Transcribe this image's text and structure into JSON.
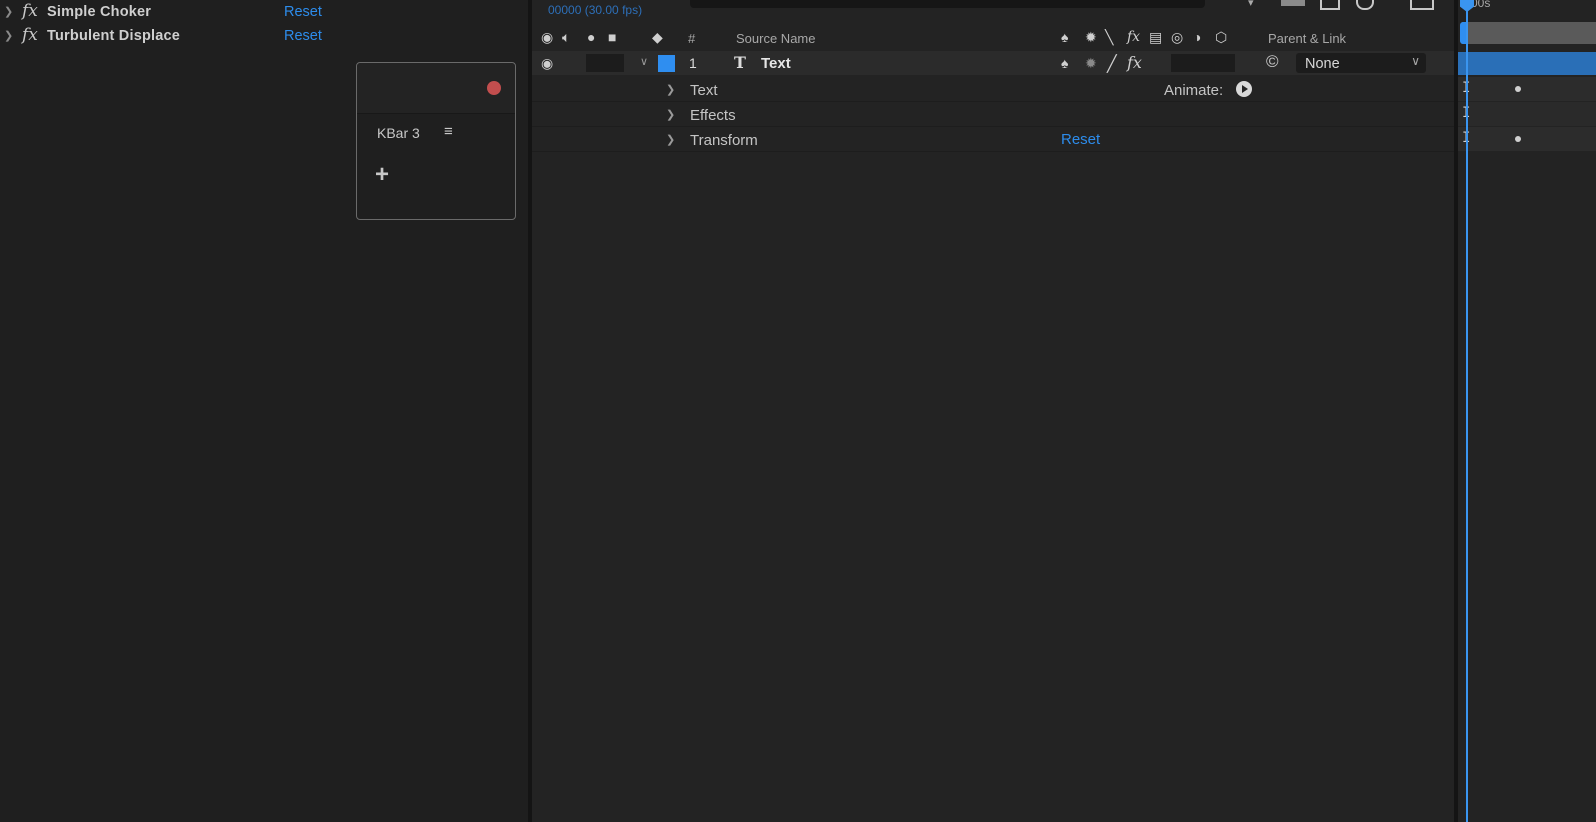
{
  "effects_panel": {
    "effects": [
      {
        "name": "Simple Choker",
        "reset_label": "Reset"
      },
      {
        "name": "Turbulent Displace",
        "reset_label": "Reset"
      }
    ],
    "fx_glyph": "fx"
  },
  "kbar": {
    "title": "KBar 3",
    "menu_glyph": "≡",
    "add_glyph": "+",
    "record_color": "#c24e4e"
  },
  "timeline": {
    "timecode": "00000 (30.00 fps)",
    "ruler_label": "00s",
    "columns": {
      "number": "#",
      "source_name": "Source Name",
      "parent_link": "Parent & Link"
    },
    "layer": {
      "number": "1",
      "type_glyph": "T",
      "name": "Text",
      "label_color": "#2f8ef0",
      "parent_value": "None"
    },
    "properties": [
      {
        "label": "Text"
      },
      {
        "label": "Effects"
      },
      {
        "label": "Transform"
      }
    ],
    "animate_label": "Animate:",
    "transform_reset": "Reset",
    "accent_color": "#2d8ceb"
  }
}
